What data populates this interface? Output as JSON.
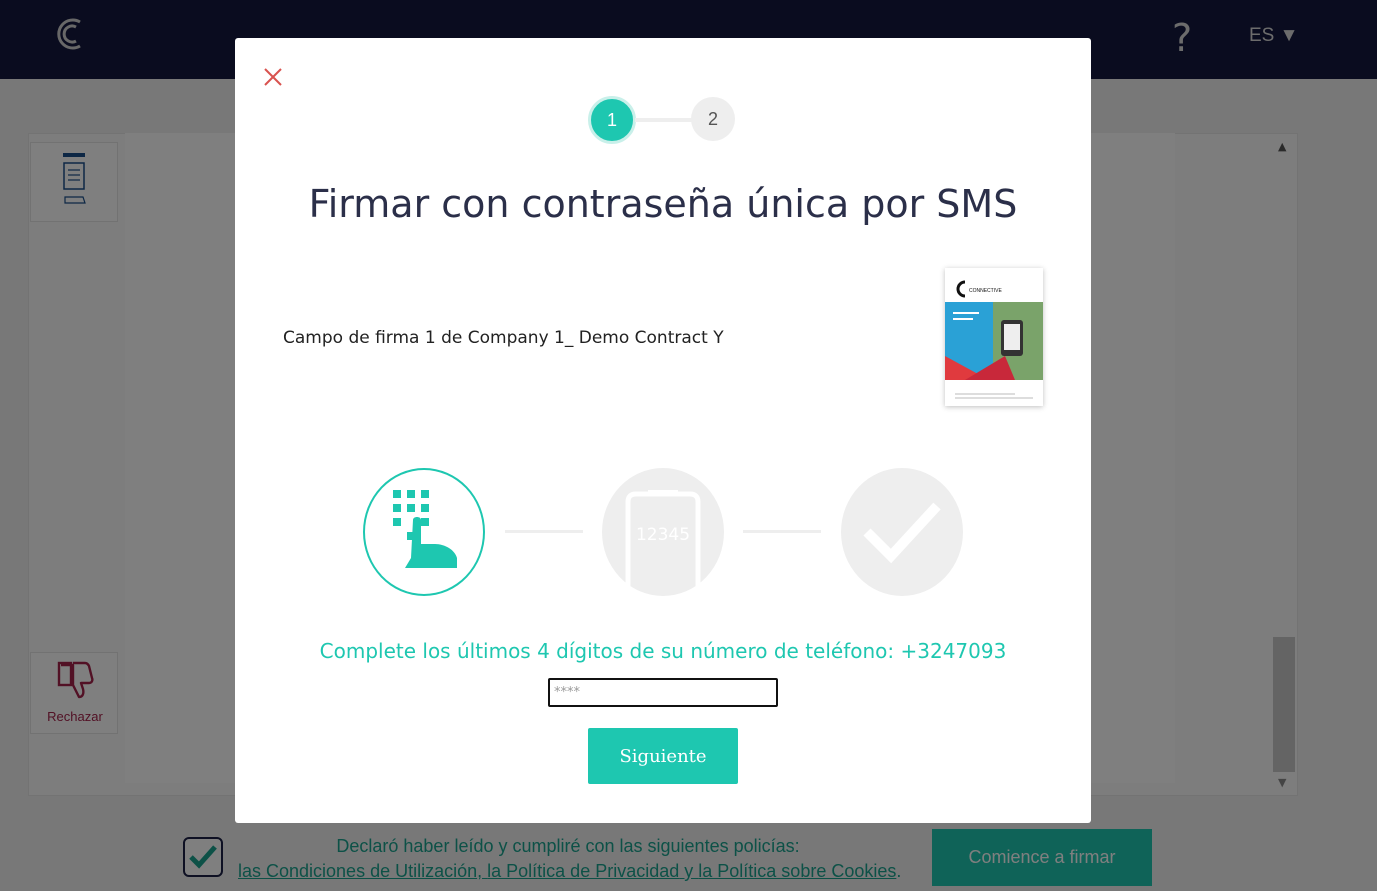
{
  "header": {
    "help_label": "?",
    "language": "ES ▼"
  },
  "sidebar": {
    "reject_label": "Rechazar"
  },
  "footer": {
    "declaration_line1": "Declaró haber leído y cumpliré con las siguientes policías:",
    "link_terms": "las Condiciones de Utilización",
    "sep1": ", ",
    "link_privacy": "la Política de Privacidad",
    "sep2": " y ",
    "link_cookies": "la Política sobre Cookies",
    "end": ".",
    "start_button": "Comience a firmar"
  },
  "modal": {
    "steps": [
      "1",
      "2"
    ],
    "title": "Firmar con contraseña única por SMS",
    "field_label": "Campo de firma 1 de Company 1_ Demo Contract Y",
    "doc_thumb_brand": "CONNECTIVE",
    "phone_display": "12345",
    "instruction": "Complete los últimos 4 dígitos de su número de teléfono: +3247093",
    "digits_placeholder": "****",
    "next_button": "Siguiente"
  },
  "colors": {
    "accent": "#1ec7b0",
    "navbar": "#14193f",
    "reject": "#a5234b",
    "close": "#d9534f"
  },
  "icons": [
    "connective-logo-icon",
    "help-icon",
    "document-icon",
    "thumbs-down-icon",
    "close-icon",
    "keypad-hand-icon",
    "phone-code-icon",
    "checkmark-icon",
    "checkbox-checked-icon"
  ]
}
